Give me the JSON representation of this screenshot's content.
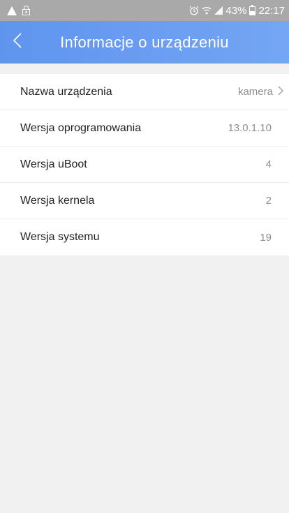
{
  "status_bar": {
    "left_icons": [
      "warning-icon",
      "lock-icon"
    ],
    "right_icons": [
      "alarm-icon",
      "wifi-icon",
      "signal-icon",
      "battery-icon"
    ],
    "battery": "43%",
    "time": "22:17"
  },
  "header": {
    "title": "Informacje o urządzeniu",
    "back_icon": "chevron-left-icon",
    "background": "#6a9bf1"
  },
  "info": {
    "rows": [
      {
        "label": "Nazwa urządzenia",
        "value": "kamera",
        "has_chevron": true
      },
      {
        "label": "Wersja oprogramowania",
        "value": "13.0.1.10"
      },
      {
        "label": "Wersja uBoot",
        "value": "4"
      },
      {
        "label": "Wersja kernela",
        "value": "2"
      },
      {
        "label": "Wersja systemu",
        "value": "19"
      }
    ]
  }
}
